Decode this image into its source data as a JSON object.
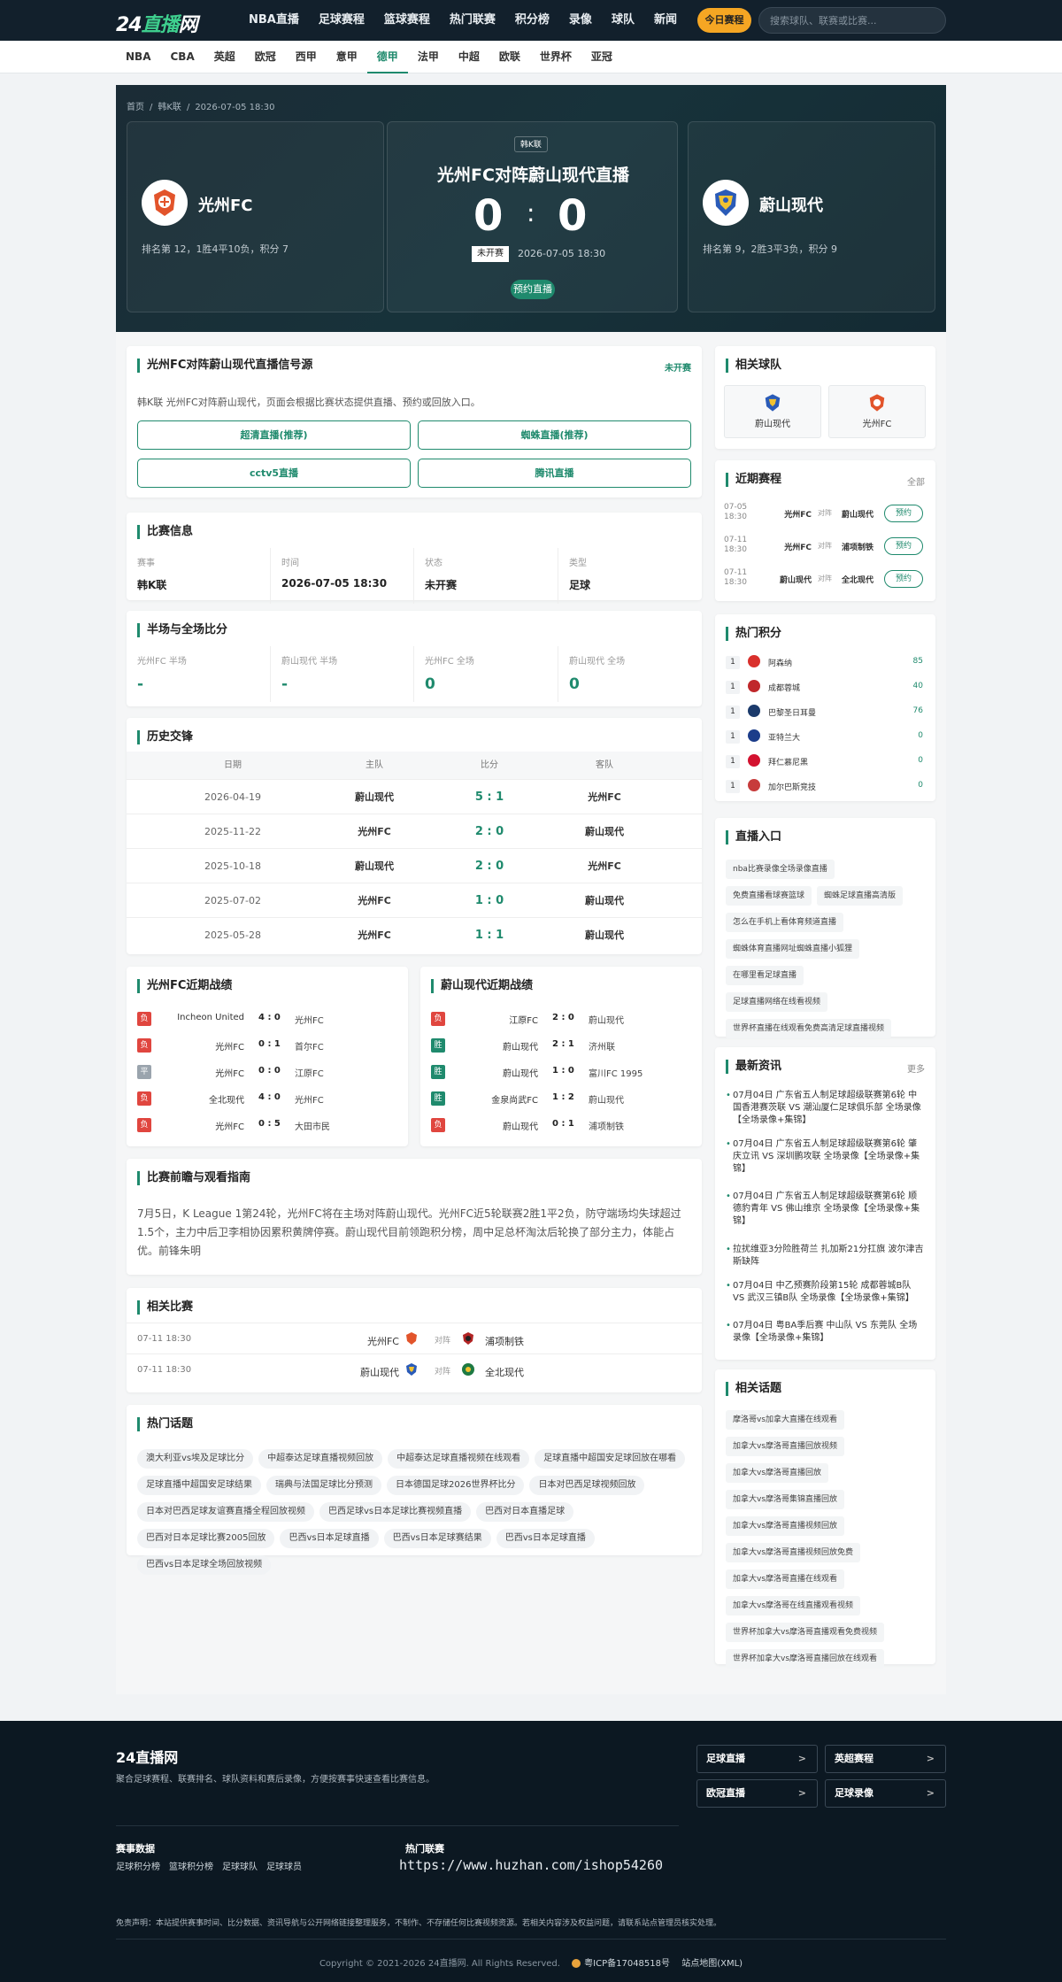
{
  "header": {
    "logo_main": "24直播网",
    "nav": [
      "NBA直播",
      "足球赛程",
      "篮球赛程",
      "热门联赛",
      "积分榜",
      "录像",
      "球队",
      "新闻"
    ],
    "today_btn": "今日赛程",
    "search_placeholder": "搜索球队、联赛或比赛..."
  },
  "subnav": {
    "items": [
      "NBA",
      "CBA",
      "英超",
      "欧冠",
      "西甲",
      "意甲",
      "德甲",
      "法甲",
      "中超",
      "欧联",
      "世界杯",
      "亚冠"
    ],
    "active": "德甲"
  },
  "hero": {
    "breadcrumb": [
      "首页",
      "/",
      "韩K联",
      "/",
      "2026-07-05 18:30"
    ],
    "league": "韩K联",
    "title": "光州FC对阵蔚山现代直播",
    "home_score": "0",
    "away_score": "0",
    "status": "未开赛",
    "time": "2026-07-05 18:30",
    "reserve": "预约直播",
    "home": {
      "name": "光州FC",
      "stat": "排名第 12，1胜4平10负，积分 7"
    },
    "away": {
      "name": "蔚山现代",
      "stat": "排名第 9，2胜3平3负，积分 9"
    }
  },
  "sources": {
    "title": "光州FC对阵蔚山现代直播信号源",
    "tag": "未开赛",
    "desc": "韩K联 光州FC对阵蔚山现代，页面会根据比赛状态提供直播、预约或回放入口。",
    "buttons": [
      "超清直播(推荐)",
      "蜘蛛直播(推荐)",
      "cctv5直播",
      "腾讯直播"
    ]
  },
  "info": {
    "title": "比赛信息",
    "cells": [
      {
        "label": "赛事",
        "value": "韩K联"
      },
      {
        "label": "时间",
        "value": "2026-07-05 18:30"
      },
      {
        "label": "状态",
        "value": "未开赛"
      },
      {
        "label": "类型",
        "value": "足球"
      }
    ]
  },
  "halftime": {
    "title": "半场与全场比分",
    "cells": [
      {
        "label": "光州FC 半场",
        "value": "-"
      },
      {
        "label": "蔚山现代 半场",
        "value": "-"
      },
      {
        "label": "光州FC 全场",
        "value": "0"
      },
      {
        "label": "蔚山现代 全场",
        "value": "0"
      }
    ]
  },
  "h2h": {
    "title": "历史交锋",
    "headers": [
      "日期",
      "主队",
      "比分",
      "客队"
    ],
    "rows": [
      {
        "date": "2026-04-19",
        "home": "蔚山现代",
        "score": "5 : 1",
        "away": "光州FC"
      },
      {
        "date": "2025-11-22",
        "home": "光州FC",
        "score": "2 : 0",
        "away": "蔚山现代"
      },
      {
        "date": "2025-10-18",
        "home": "蔚山现代",
        "score": "2 : 0",
        "away": "光州FC"
      },
      {
        "date": "2025-07-02",
        "home": "光州FC",
        "score": "1 : 0",
        "away": "蔚山现代"
      },
      {
        "date": "2025-05-28",
        "home": "光州FC",
        "score": "1 : 1",
        "away": "蔚山现代"
      }
    ]
  },
  "recent_home": {
    "title": "光州FC近期战绩",
    "rows": [
      {
        "r": "负",
        "c": "L",
        "home": "Incheon United",
        "score": "4 : 0",
        "away": "光州FC"
      },
      {
        "r": "负",
        "c": "L",
        "home": "光州FC",
        "score": "0 : 1",
        "away": "首尔FC"
      },
      {
        "r": "平",
        "c": "D",
        "home": "光州FC",
        "score": "0 : 0",
        "away": "江原FC"
      },
      {
        "r": "负",
        "c": "L",
        "home": "全北现代",
        "score": "4 : 0",
        "away": "光州FC"
      },
      {
        "r": "负",
        "c": "L",
        "home": "光州FC",
        "score": "0 : 5",
        "away": "大田市民"
      }
    ]
  },
  "recent_away": {
    "title": "蔚山现代近期战绩",
    "rows": [
      {
        "r": "负",
        "c": "L",
        "home": "江原FC",
        "score": "2 : 0",
        "away": "蔚山现代"
      },
      {
        "r": "胜",
        "c": "W",
        "home": "蔚山现代",
        "score": "2 : 1",
        "away": "济州联"
      },
      {
        "r": "胜",
        "c": "W",
        "home": "蔚山现代",
        "score": "1 : 0",
        "away": "富川FC 1995"
      },
      {
        "r": "胜",
        "c": "W",
        "home": "金泉尚武FC",
        "score": "1 : 2",
        "away": "蔚山现代"
      },
      {
        "r": "负",
        "c": "L",
        "home": "蔚山现代",
        "score": "0 : 1",
        "away": "浦项制铁"
      }
    ]
  },
  "guide": {
    "title": "比赛前瞻与观看指南",
    "text": "7月5日，K League 1第24轮，光州FC将在主场对阵蔚山现代。光州FC近5轮联赛2胜1平2负，防守端场均失球超过1.5个，主力中后卫李相协因累积黄牌停赛。蔚山现代目前领跑积分榜，周中足总杯淘汰后轮换了部分主力，体能占优。前锋朱明"
  },
  "related_matches": {
    "title": "相关比赛",
    "rows": [
      {
        "time": "07-11 18:30",
        "home": "光州FC",
        "vs": "对阵",
        "away": "浦项制铁"
      },
      {
        "time": "07-11 18:30",
        "home": "蔚山现代",
        "vs": "对阵",
        "away": "全北现代"
      }
    ]
  },
  "hot_topics": {
    "title": "热门话题",
    "tags": [
      "澳大利亚vs埃及足球比分",
      "中超泰达足球直播视频回放",
      "中超泰达足球直播视频在线观看",
      "足球直播中超国安足球回放在哪看",
      "足球直播中超国安足球结果",
      "瑞典与法国足球比分预测",
      "日本德国足球2026世界杯比分",
      "日本对巴西足球视频回放",
      "日本对巴西足球友谊赛直播全程回放视频",
      "巴西足球vs日本足球比赛视频直播",
      "巴西对日本直播足球",
      "巴西对日本足球比赛2005回放",
      "巴西vs日本足球直播",
      "巴西vs日本足球赛结果",
      "巴西vs日本足球直播",
      "巴西vs日本足球全场回放视频"
    ]
  },
  "side_teams": {
    "title": "相关球队",
    "teams": [
      "蔚山现代",
      "光州FC"
    ]
  },
  "side_recent": {
    "title": "近期赛程",
    "more": "全部",
    "rows": [
      {
        "date": "07-05",
        "time": "18:30",
        "home": "光州FC",
        "vs": "对阵",
        "away": "蔚山现代",
        "btn": "预约"
      },
      {
        "date": "07-11",
        "time": "18:30",
        "home": "光州FC",
        "vs": "对阵",
        "away": "浦项制铁",
        "btn": "预约"
      },
      {
        "date": "07-11",
        "time": "18:30",
        "home": "蔚山现代",
        "vs": "对阵",
        "away": "全北现代",
        "btn": "预约"
      }
    ]
  },
  "side_standings": {
    "title": "热门积分",
    "rows": [
      {
        "rank": "1",
        "team": "阿森纳",
        "pts": "85",
        "color": "#d9302c"
      },
      {
        "rank": "1",
        "team": "成都蓉城",
        "pts": "40",
        "color": "#c0282b"
      },
      {
        "rank": "1",
        "team": "巴黎圣日耳曼",
        "pts": "76",
        "color": "#1b3a6b"
      },
      {
        "rank": "1",
        "team": "亚特兰大",
        "pts": "0",
        "color": "#1c3d8a"
      },
      {
        "rank": "1",
        "team": "拜仁慕尼黑",
        "pts": "0",
        "color": "#d3122f"
      },
      {
        "rank": "1",
        "team": "加尔巴斯竞技",
        "pts": "0",
        "color": "#c73b3b"
      }
    ]
  },
  "side_live": {
    "title": "直播入口",
    "tags": [
      "nba比赛录像全场录像直播",
      "免费直播看球赛篮球",
      "蜘蛛足球直播高清版",
      "怎么在手机上看体育频道直播",
      "蜘蛛体育直播网址蜘蛛直播小狐狸",
      "在哪里看足球直播",
      "足球直播网络在线看视频",
      "世界杯直播在线观看免费高清足球直播视频"
    ]
  },
  "side_news": {
    "title": "最新资讯",
    "more": "更多",
    "items": [
      "07月04日 广东省五人制足球超级联赛第6轮 中国香港赛茨联 VS 潮汕厦仁足球俱乐部 全场录像【全场录像+集锦】",
      "07月04日 广东省五人制足球超级联赛第6轮 肇庆立讯 VS 深圳鹏攻联 全场录像【全场录像+集锦】",
      "07月04日 广东省五人制足球超级联赛第6轮 顺德豹青年 VS 佛山维京 全场录像【全场录像+集锦】",
      "拉扰维亚3分险胜荷兰 扎加斯21分扛旗 波尔津吉斯缺阵",
      "07月04日 中乙预赛阶段第15轮 成都蓉城B队 VS 武汉三镇B队 全场录像【全场录像+集锦】",
      "07月04日 粤BA季后赛 中山队 VS 东莞队 全场录像【全场录像+集锦】"
    ]
  },
  "side_topics": {
    "title": "相关话题",
    "tags": [
      "摩洛哥vs加拿大直播在线观看",
      "加拿大vs摩洛哥直播回放视频",
      "加拿大vs摩洛哥直播回放",
      "加拿大vs摩洛哥集锦直播回放",
      "加拿大vs摩洛哥直播视频回放",
      "加拿大vs摩洛哥直播视频回放免费",
      "加拿大vs摩洛哥直播在线观看",
      "加拿大vs摩洛哥在线直播观看视频",
      "世界杯加拿大vs摩洛哥直播观看免费视频",
      "世界杯加拿大vs摩洛哥直播回放在线观看"
    ]
  },
  "footer": {
    "brand": "24直播网",
    "desc": "聚合足球赛程、联赛排名、球队资料和赛后录像，方便按赛事快速查看比赛信息。",
    "buttons": [
      "足球直播",
      "英超赛程",
      "欧冠直播",
      "足球录像"
    ],
    "col1_title": "赛事数据",
    "col1_links": [
      "足球积分榜",
      "篮球积分榜",
      "足球球队",
      "足球球员"
    ],
    "col2_title": "热门联赛",
    "watermark": "https://www.huzhan.com/ishop54260",
    "disclaimer": "免责声明：本站提供赛事时间、比分数据、资讯导航与公开网络链接整理服务，不制作、不存储任何比赛视频资源。若相关内容涉及权益问题，请联系站点管理员核实处理。",
    "copyright": "Copyright © 2021-2026 24直播网. All Rights Reserved.",
    "icp": "粤ICP备17048518号",
    "sitemap": "站点地图(XML)"
  }
}
